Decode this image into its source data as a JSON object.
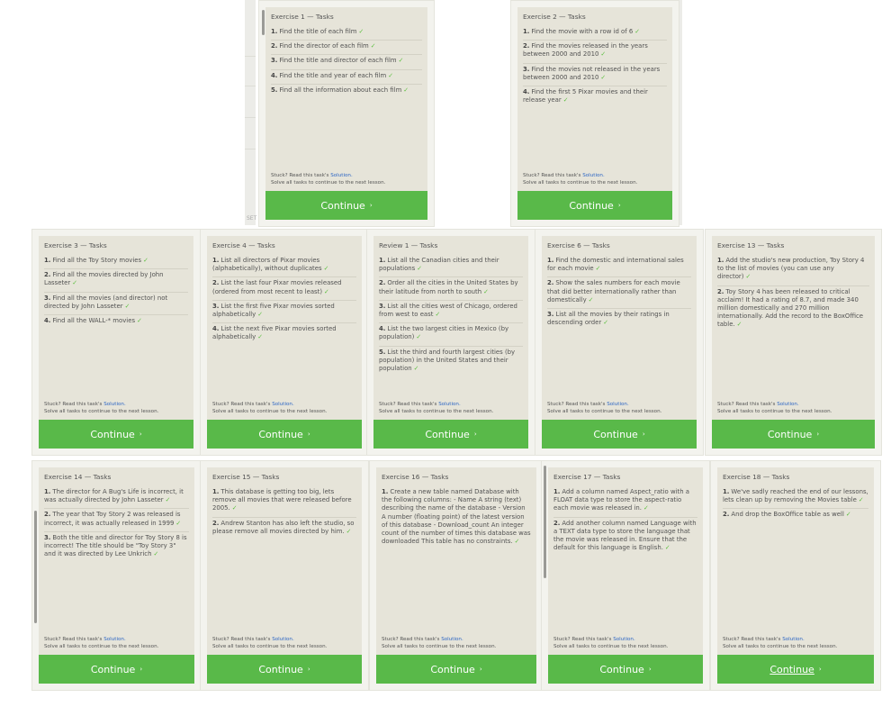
{
  "stuck_prefix": "Stuck? Read this task's",
  "solution_label": "Solution.",
  "solve_note": "Solve all tasks to continue to the next lesson.",
  "continue_label": "Continue",
  "arrow": "›",
  "check": "✓",
  "set_label": "SET",
  "cards": [
    {
      "title": "Exercise 1 — Tasks",
      "tasks": [
        "Find the title of each film",
        "Find the director of each film",
        "Find the title and director of each film",
        "Find the title and year of each film",
        "Find all the information about each film"
      ]
    },
    {
      "title": "Exercise 2 — Tasks",
      "tasks": [
        "Find the movie with a row id of 6",
        "Find the movies released in the years between 2000 and 2010",
        "Find the movies not released in the years between 2000 and 2010",
        "Find the first 5 Pixar movies and their release year"
      ]
    },
    {
      "title": "Exercise 3 — Tasks",
      "tasks": [
        "Find all the Toy Story movies",
        "Find all the movies directed by John Lasseter",
        "Find all the movies (and director) not directed by John Lasseter",
        "Find all the WALL-* movies"
      ]
    },
    {
      "title": "Exercise 4 — Tasks",
      "tasks": [
        "List all directors of Pixar movies (alphabetically), without duplicates",
        "List the last four Pixar movies released (ordered from most recent to least)",
        "List the first five Pixar movies sorted alphabetically",
        "List the next five Pixar movies sorted alphabetically"
      ]
    },
    {
      "title": "Review 1 — Tasks",
      "tasks": [
        "List all the Canadian cities and their populations",
        "Order all the cities in the United States by their latitude from north to south",
        "List all the cities west of Chicago, ordered from west to east",
        "List the two largest cities in Mexico (by population)",
        "List the third and fourth largest cities (by population) in the United States and their population"
      ]
    },
    {
      "title": "Exercise 6 — Tasks",
      "tasks": [
        "Find the domestic and international sales for each movie",
        "Show the sales numbers for each movie that did better internationally rather than domestically",
        "List all the movies by their ratings in descending order"
      ]
    },
    {
      "title": "Exercise 13 — Tasks",
      "tasks": [
        "Add the studio's new production, Toy Story 4 to the list of movies (you can use any director)",
        "Toy Story 4 has been released to critical acclaim! It had a rating of 8.7, and made 340 million domestically and 270 million internationally. Add the record to the BoxOffice table."
      ]
    },
    {
      "title": "Exercise 14 — Tasks",
      "tasks": [
        "The director for A Bug's Life is incorrect, it was actually directed by John Lasseter",
        "The year that Toy Story 2 was released is incorrect, it was actually released in 1999",
        "Both the title and director for Toy Story 8 is incorrect! The title should be \"Toy Story 3\" and it was directed by Lee Unkrich"
      ]
    },
    {
      "title": "Exercise 15 — Tasks",
      "tasks": [
        "This database is getting too big, lets remove all movies that were released before 2005.",
        "Andrew Stanton has also left the studio, so please remove all movies directed by him."
      ]
    },
    {
      "title": "Exercise 16 — Tasks",
      "tasks": [
        "Create a new table named Database with the following columns: - Name A string (text) describing the name of the database - Version A number (floating point) of the latest version of this database - Download_count An integer count of the number of times this database was downloaded This table has no constraints."
      ]
    },
    {
      "title": "Exercise 17 — Tasks",
      "tasks": [
        "Add a column named Aspect_ratio with a FLOAT data type to store the aspect-ratio each movie was released in.",
        "Add another column named Language with a TEXT data type to store the language that the movie was released in. Ensure that the default for this language is English."
      ]
    },
    {
      "title": "Exercise 18 — Tasks",
      "tasks": [
        "We've sadly reached the end of our lessons, lets clean up by removing the Movies table",
        "And drop the BoxOffice table as well"
      ]
    }
  ]
}
